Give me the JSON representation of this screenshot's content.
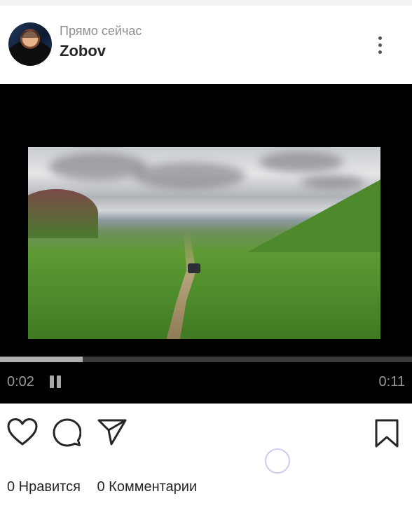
{
  "post": {
    "time_ago": "Прямо сейчас",
    "username": "Zobov"
  },
  "video": {
    "current_time": "0:02",
    "total_time": "0:11",
    "progress": 0.2,
    "state": "playing"
  },
  "actions": {
    "icons": [
      "heart-icon",
      "comment-icon",
      "send-icon",
      "bookmark-icon"
    ]
  },
  "stats": {
    "likes_label": "0 Нравится",
    "comments_label": "0 Комментарии"
  },
  "colors": {
    "video_background": "#000000",
    "text_primary": "#262626",
    "text_secondary": "#8e8e8e"
  }
}
